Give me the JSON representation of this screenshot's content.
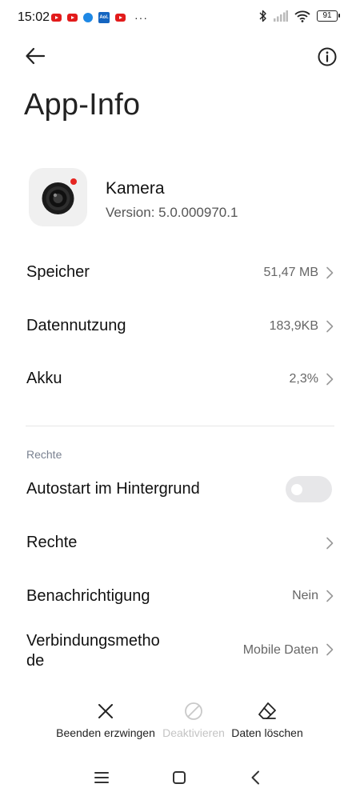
{
  "status_bar": {
    "time": "15:02",
    "notifications": [
      "youtube-icon",
      "youtube-icon",
      "app-icon",
      "aol-icon",
      "youtube-icon"
    ],
    "aol_label": "Aol.",
    "more": "···",
    "battery": "91"
  },
  "header": {
    "title": "App-Info"
  },
  "app": {
    "name": "Kamera",
    "version": "Version: 5.0.000970.1",
    "accent_color": "#e52521"
  },
  "rows": {
    "storage": {
      "label": "Speicher",
      "value": "51,47 MB"
    },
    "data_usage": {
      "label": "Datennutzung",
      "value": "183,9KB"
    },
    "battery": {
      "label": "Akku",
      "value": "2,3%"
    }
  },
  "permissions_section": {
    "title": "Rechte",
    "autostart": {
      "label": "Autostart im Hintergrund",
      "enabled": false
    },
    "permissions": {
      "label": "Rechte"
    },
    "notifications": {
      "label": "Benachrichtigung",
      "value": "Nein"
    },
    "connection": {
      "label_line1": "Verbindungsmetho",
      "label_line2": "de",
      "value": "Mobile Daten"
    }
  },
  "actions": {
    "force_stop": "Beenden erzwingen",
    "disable": "Deaktivieren",
    "clear_data": "Daten löschen"
  }
}
